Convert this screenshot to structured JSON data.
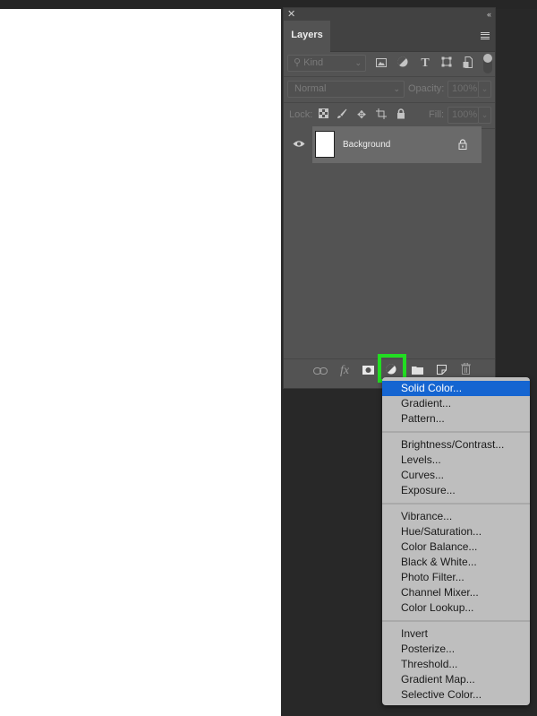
{
  "panel": {
    "close_icon": "close-icon",
    "collapse_icon": "collapse-icon",
    "tab_label": "Layers",
    "menu_icon": "panel-menu-icon",
    "filter": {
      "kind_label": "Kind",
      "icons": [
        "image-filter-icon",
        "adjustment-filter-icon",
        "type-filter-icon",
        "shape-filter-icon",
        "smart-object-filter-icon"
      ]
    },
    "blend": {
      "mode": "Normal",
      "opacity_label": "Opacity:",
      "opacity_value": "100%"
    },
    "lock": {
      "label": "Lock:",
      "icons": [
        "lock-transparent-pixels-icon",
        "lock-image-pixels-icon",
        "lock-position-icon",
        "lock-artboard-icon",
        "lock-all-icon"
      ],
      "fill_label": "Fill:",
      "fill_value": "100%"
    },
    "layers": [
      {
        "name": "Background",
        "visible": true,
        "locked": true
      }
    ],
    "bottom_icons": [
      "link-layers-icon",
      "layer-style-icon",
      "add-mask-icon",
      "new-adjustment-layer-icon",
      "new-group-icon",
      "new-layer-icon",
      "delete-layer-icon"
    ]
  },
  "highlight_color": "#22dd22",
  "adjustment_menu": {
    "groups": [
      [
        "Solid Color...",
        "Gradient...",
        "Pattern..."
      ],
      [
        "Brightness/Contrast...",
        "Levels...",
        "Curves...",
        "Exposure..."
      ],
      [
        "Vibrance...",
        "Hue/Saturation...",
        "Color Balance...",
        "Black & White...",
        "Photo Filter...",
        "Channel Mixer...",
        "Color Lookup..."
      ],
      [
        "Invert",
        "Posterize...",
        "Threshold...",
        "Gradient Map...",
        "Selective Color..."
      ]
    ],
    "selected": "Solid Color...",
    "selected_color": "#1565d1"
  }
}
